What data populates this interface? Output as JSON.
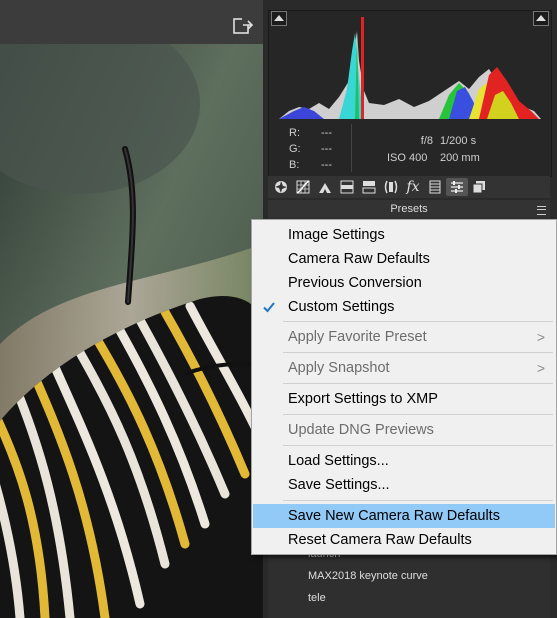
{
  "histogram": {
    "readout": {
      "r_label": "R:",
      "g_label": "G:",
      "b_label": "B:",
      "r": "---",
      "g": "---",
      "b": "---"
    },
    "camera": {
      "aperture": "f/8",
      "shutter": "1/200 s",
      "iso": "ISO 400",
      "focal_length": "200 mm"
    }
  },
  "tool_tabs": [
    "aperture-icon",
    "tone-curve-icon",
    "detail-icon",
    "hsl-icon",
    "split-toning-icon",
    "lens-icon",
    "fx-icon",
    "calibration-icon",
    "presets-icon",
    "snapshots-icon"
  ],
  "presets": {
    "title": "Presets",
    "visible_items": [
      "launch",
      "MAX2018 keynote curve",
      "tele"
    ]
  },
  "context_menu": {
    "items": [
      {
        "label": "Image Settings",
        "state": "normal"
      },
      {
        "label": "Camera Raw Defaults",
        "state": "normal"
      },
      {
        "label": "Previous Conversion",
        "state": "normal"
      },
      {
        "label": "Custom Settings",
        "state": "checked"
      },
      {
        "label": "Apply Favorite Preset",
        "state": "disabled",
        "submenu": true
      },
      {
        "label": "Apply Snapshot",
        "state": "disabled",
        "submenu": true
      },
      {
        "label": "Export Settings to XMP",
        "state": "normal"
      },
      {
        "label": "Update DNG Previews",
        "state": "disabled"
      },
      {
        "label": "Load Settings...",
        "state": "normal"
      },
      {
        "label": "Save Settings...",
        "state": "normal"
      },
      {
        "label": "Save New Camera Raw Defaults",
        "state": "highlighted"
      },
      {
        "label": "Reset Camera Raw Defaults",
        "state": "normal"
      }
    ],
    "submenu_arrow": ">"
  },
  "colors": {
    "menu_highlight": "#91c9f7",
    "menu_background": "#f0f0f0",
    "check_mark": "#1e74c4",
    "panel_background": "#2a2a2a"
  }
}
